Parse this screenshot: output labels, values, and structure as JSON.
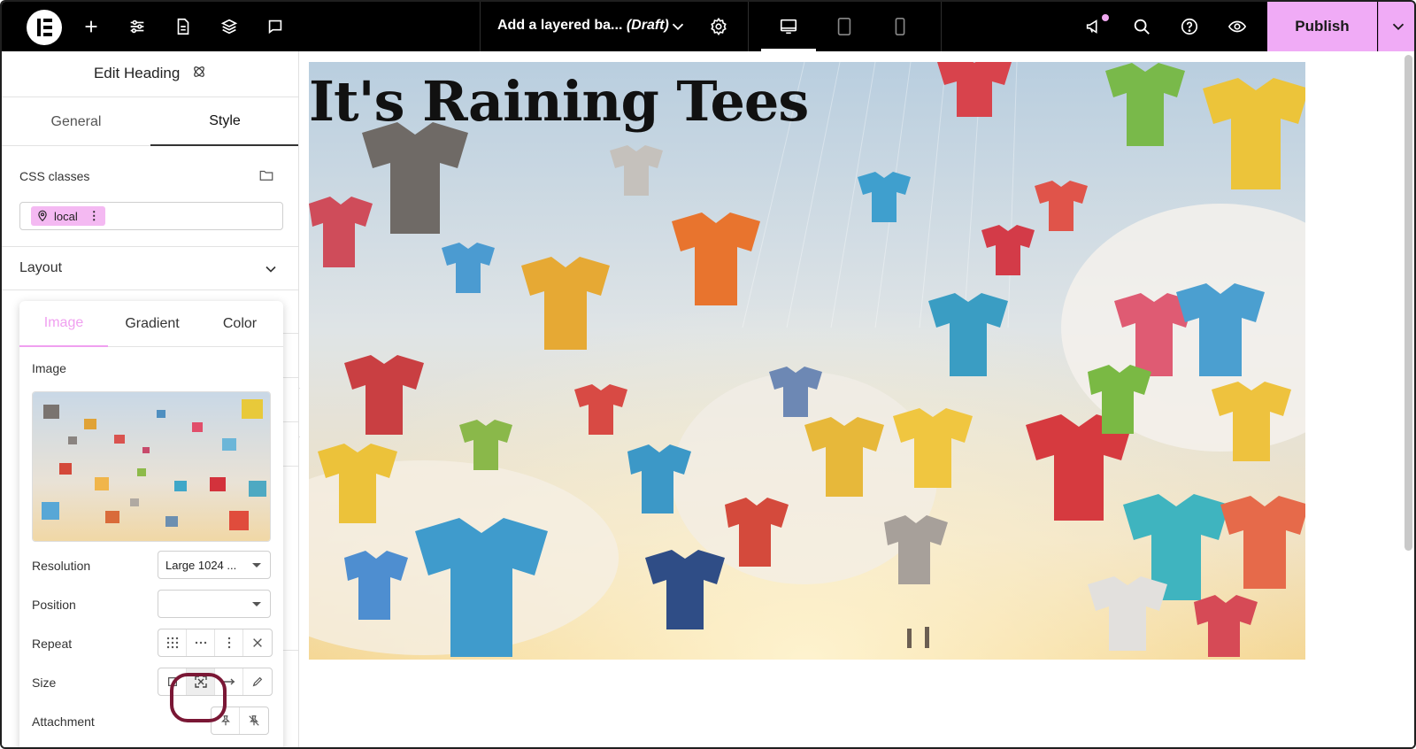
{
  "topbar": {
    "document_name": "Add a layered ba...",
    "document_status": "(Draft)",
    "publish_label": "Publish",
    "icons": [
      "plus-icon",
      "sliders-icon",
      "page-icon",
      "layers-icon",
      "comment-icon",
      "gear-icon",
      "desktop-icon",
      "tablet-icon",
      "mobile-icon",
      "megaphone-icon",
      "search-icon",
      "help-icon",
      "eye-icon",
      "chevron-down-icon"
    ],
    "accent": "#f0abf6"
  },
  "panel": {
    "title": "Edit Heading",
    "tabs": [
      "General",
      "Style"
    ],
    "active_tab": "Style",
    "css_classes_label": "CSS classes",
    "class_chip": "local",
    "layout_label": "Layout"
  },
  "background_popover": {
    "tabs": [
      "Image",
      "Gradient",
      "Color"
    ],
    "active_tab": "Image",
    "image_label": "Image",
    "resolution_label": "Resolution",
    "resolution_value": "Large 1024 ...",
    "position_label": "Position",
    "position_value": "",
    "repeat_label": "Repeat",
    "size_label": "Size",
    "attachment_label": "Attachment"
  },
  "canvas": {
    "heading": "It's Raining Tees"
  }
}
